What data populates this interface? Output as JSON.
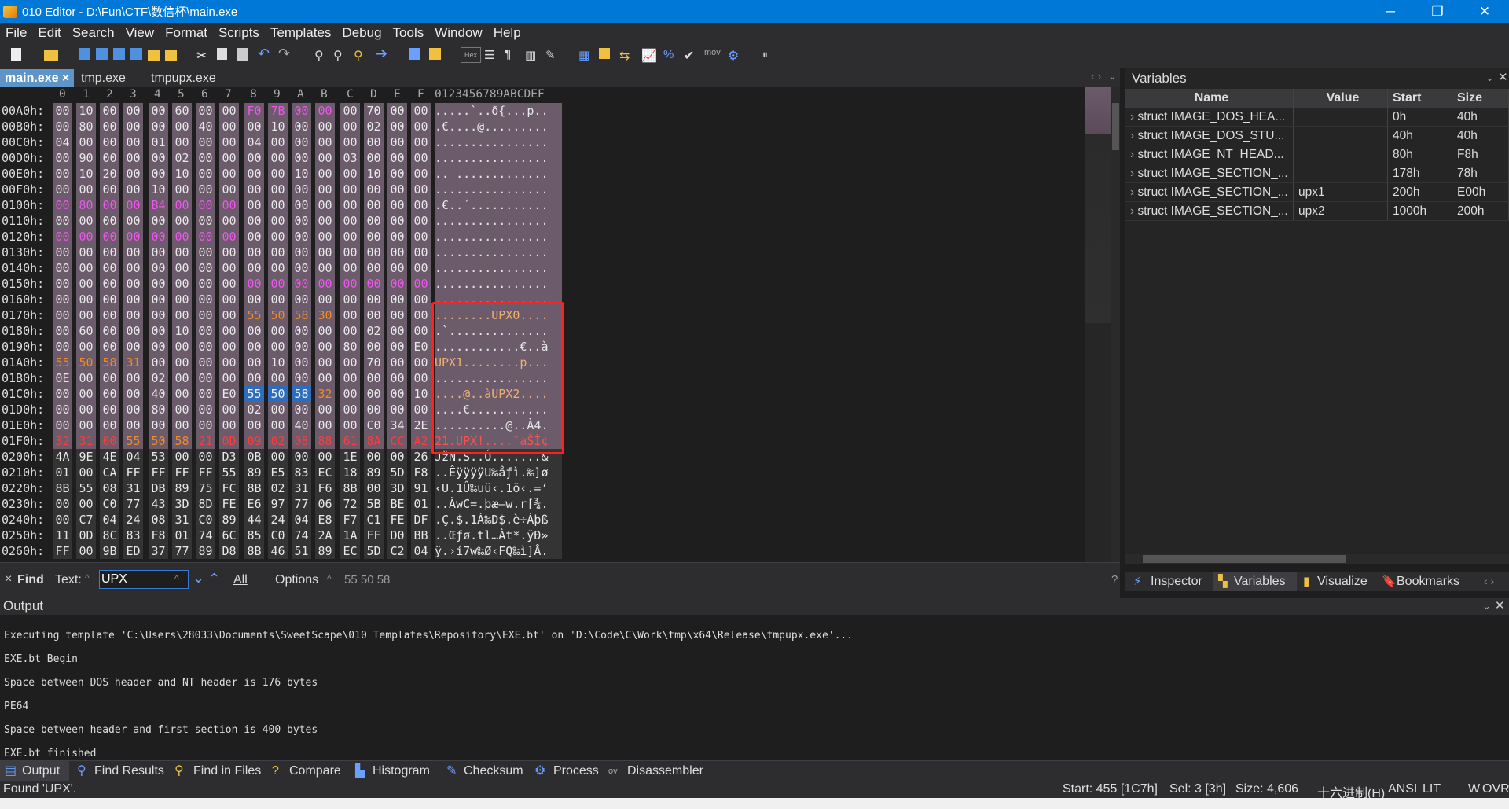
{
  "window": {
    "title": "010 Editor - D:\\Fun\\CTF\\数信杯\\main.exe",
    "min": "─",
    "max": "❐",
    "close": "✕"
  },
  "menu": [
    "File",
    "Edit",
    "Search",
    "View",
    "Format",
    "Scripts",
    "Templates",
    "Debug",
    "Tools",
    "Window",
    "Help"
  ],
  "tabs": [
    {
      "label": "main.exe ×",
      "active": true
    },
    {
      "label": "tmp.exe",
      "active": false
    },
    {
      "label": "tmpupx.exe",
      "active": false
    }
  ],
  "hex": {
    "columns": [
      "0",
      "1",
      "2",
      "3",
      "4",
      "5",
      "6",
      "7",
      "8",
      "9",
      "A",
      "B",
      "C",
      "D",
      "E",
      "F"
    ],
    "ascii_header": "0123456789ABCDEF",
    "rows": [
      {
        "addr": "00A0h:",
        "bytes": [
          "00",
          "10",
          "00",
          "00",
          "00",
          "60",
          "00",
          "00",
          "F0",
          "7B",
          "00",
          "00",
          "00",
          "70",
          "00",
          "00"
        ],
        "ascii": ".....`..ð{...p.."
      },
      {
        "addr": "00B0h:",
        "bytes": [
          "00",
          "80",
          "00",
          "00",
          "00",
          "00",
          "40",
          "00",
          "00",
          "10",
          "00",
          "00",
          "00",
          "02",
          "00",
          "00"
        ],
        "ascii": ".€....@........."
      },
      {
        "addr": "00C0h:",
        "bytes": [
          "04",
          "00",
          "00",
          "00",
          "01",
          "00",
          "00",
          "00",
          "04",
          "00",
          "00",
          "00",
          "00",
          "00",
          "00",
          "00"
        ],
        "ascii": "................"
      },
      {
        "addr": "00D0h:",
        "bytes": [
          "00",
          "90",
          "00",
          "00",
          "00",
          "02",
          "00",
          "00",
          "00",
          "00",
          "00",
          "00",
          "03",
          "00",
          "00",
          "00"
        ],
        "ascii": "................"
      },
      {
        "addr": "00E0h:",
        "bytes": [
          "00",
          "10",
          "20",
          "00",
          "00",
          "10",
          "00",
          "00",
          "00",
          "00",
          "10",
          "00",
          "00",
          "10",
          "00",
          "00"
        ],
        "ascii": ".. ............."
      },
      {
        "addr": "00F0h:",
        "bytes": [
          "00",
          "00",
          "00",
          "00",
          "10",
          "00",
          "00",
          "00",
          "00",
          "00",
          "00",
          "00",
          "00",
          "00",
          "00",
          "00"
        ],
        "ascii": "................"
      },
      {
        "addr": "0100h:",
        "bytes": [
          "00",
          "80",
          "00",
          "00",
          "B4",
          "00",
          "00",
          "00",
          "00",
          "00",
          "00",
          "00",
          "00",
          "00",
          "00",
          "00"
        ],
        "ascii": ".€..´..........."
      },
      {
        "addr": "0110h:",
        "bytes": [
          "00",
          "00",
          "00",
          "00",
          "00",
          "00",
          "00",
          "00",
          "00",
          "00",
          "00",
          "00",
          "00",
          "00",
          "00",
          "00"
        ],
        "ascii": "................"
      },
      {
        "addr": "0120h:",
        "bytes": [
          "00",
          "00",
          "00",
          "00",
          "00",
          "00",
          "00",
          "00",
          "00",
          "00",
          "00",
          "00",
          "00",
          "00",
          "00",
          "00"
        ],
        "ascii": "................"
      },
      {
        "addr": "0130h:",
        "bytes": [
          "00",
          "00",
          "00",
          "00",
          "00",
          "00",
          "00",
          "00",
          "00",
          "00",
          "00",
          "00",
          "00",
          "00",
          "00",
          "00"
        ],
        "ascii": "................"
      },
      {
        "addr": "0140h:",
        "bytes": [
          "00",
          "00",
          "00",
          "00",
          "00",
          "00",
          "00",
          "00",
          "00",
          "00",
          "00",
          "00",
          "00",
          "00",
          "00",
          "00"
        ],
        "ascii": "................"
      },
      {
        "addr": "0150h:",
        "bytes": [
          "00",
          "00",
          "00",
          "00",
          "00",
          "00",
          "00",
          "00",
          "00",
          "00",
          "00",
          "00",
          "00",
          "00",
          "00",
          "00"
        ],
        "ascii": "................"
      },
      {
        "addr": "0160h:",
        "bytes": [
          "00",
          "00",
          "00",
          "00",
          "00",
          "00",
          "00",
          "00",
          "00",
          "00",
          "00",
          "00",
          "00",
          "00",
          "00",
          "00"
        ],
        "ascii": "................"
      },
      {
        "addr": "0170h:",
        "bytes": [
          "00",
          "00",
          "00",
          "00",
          "00",
          "00",
          "00",
          "00",
          "55",
          "50",
          "58",
          "30",
          "00",
          "00",
          "00",
          "00"
        ],
        "ascii": "........UPX0...."
      },
      {
        "addr": "0180h:",
        "bytes": [
          "00",
          "60",
          "00",
          "00",
          "00",
          "10",
          "00",
          "00",
          "00",
          "00",
          "00",
          "00",
          "00",
          "02",
          "00",
          "00"
        ],
        "ascii": ".`.............."
      },
      {
        "addr": "0190h:",
        "bytes": [
          "00",
          "00",
          "00",
          "00",
          "00",
          "00",
          "00",
          "00",
          "00",
          "00",
          "00",
          "00",
          "80",
          "00",
          "00",
          "E0"
        ],
        "ascii": "............€..à"
      },
      {
        "addr": "01A0h:",
        "bytes": [
          "55",
          "50",
          "58",
          "31",
          "00",
          "00",
          "00",
          "00",
          "00",
          "10",
          "00",
          "00",
          "00",
          "70",
          "00",
          "00"
        ],
        "ascii": "UPX1........p..."
      },
      {
        "addr": "01B0h:",
        "bytes": [
          "0E",
          "00",
          "00",
          "00",
          "02",
          "00",
          "00",
          "00",
          "00",
          "00",
          "00",
          "00",
          "00",
          "00",
          "00",
          "00"
        ],
        "ascii": "................"
      },
      {
        "addr": "01C0h:",
        "bytes": [
          "00",
          "00",
          "00",
          "00",
          "40",
          "00",
          "00",
          "E0",
          "55",
          "50",
          "58",
          "32",
          "00",
          "00",
          "00",
          "10"
        ],
        "ascii": "....@..àUPX2...."
      },
      {
        "addr": "01D0h:",
        "bytes": [
          "00",
          "00",
          "00",
          "00",
          "80",
          "00",
          "00",
          "00",
          "02",
          "00",
          "00",
          "00",
          "00",
          "00",
          "00",
          "00"
        ],
        "ascii": "....€..........."
      },
      {
        "addr": "01E0h:",
        "bytes": [
          "00",
          "00",
          "00",
          "00",
          "00",
          "00",
          "00",
          "00",
          "00",
          "00",
          "40",
          "00",
          "00",
          "C0",
          "34",
          "2E"
        ],
        "ascii": "..........@..À4."
      },
      {
        "addr": "01F0h:",
        "bytes": [
          "32",
          "31",
          "00",
          "55",
          "50",
          "58",
          "21",
          "0D",
          "09",
          "02",
          "08",
          "88",
          "61",
          "8A",
          "CC",
          "A2"
        ],
        "ascii": "21.UPX!....ˆaŠÌ¢"
      },
      {
        "addr": "0200h:",
        "bytes": [
          "4A",
          "9E",
          "4E",
          "04",
          "53",
          "00",
          "00",
          "D3",
          "0B",
          "00",
          "00",
          "00",
          "1E",
          "00",
          "00",
          "26"
        ],
        "ascii": "JžN.S..Ó.......&"
      },
      {
        "addr": "0210h:",
        "bytes": [
          "01",
          "00",
          "CA",
          "FF",
          "FF",
          "FF",
          "FF",
          "55",
          "89",
          "E5",
          "83",
          "EC",
          "18",
          "89",
          "5D",
          "F8"
        ],
        "ascii": "..ÊÿÿÿÿU‰åƒì.‰]ø"
      },
      {
        "addr": "0220h:",
        "bytes": [
          "8B",
          "55",
          "08",
          "31",
          "DB",
          "89",
          "75",
          "FC",
          "8B",
          "02",
          "31",
          "F6",
          "8B",
          "00",
          "3D",
          "91"
        ],
        "ascii": "‹U.1Û‰uü‹.1ö‹.=‘"
      },
      {
        "addr": "0230h:",
        "bytes": [
          "00",
          "00",
          "C0",
          "77",
          "43",
          "3D",
          "8D",
          "FE",
          "E6",
          "97",
          "77",
          "06",
          "72",
          "5B",
          "BE",
          "01"
        ],
        "ascii": "..ÀwC=.þæ—w.r[¾."
      },
      {
        "addr": "0240h:",
        "bytes": [
          "00",
          "C7",
          "04",
          "24",
          "08",
          "31",
          "C0",
          "89",
          "44",
          "24",
          "04",
          "E8",
          "F7",
          "C1",
          "FE",
          "DF"
        ],
        "ascii": ".Ç.$.1À‰D$.è÷Áþß"
      },
      {
        "addr": "0250h:",
        "bytes": [
          "11",
          "0D",
          "8C",
          "83",
          "F8",
          "01",
          "74",
          "6C",
          "85",
          "C0",
          "74",
          "2A",
          "1A",
          "FF",
          "D0",
          "BB"
        ],
        "ascii": "..Œƒø.tl…Àt*.ÿÐ»"
      },
      {
        "addr": "0260h:",
        "bytes": [
          "FF",
          "00",
          "9B",
          "ED",
          "37",
          "77",
          "89",
          "D8",
          "8B",
          "46",
          "51",
          "89",
          "EC",
          "5D",
          "C2",
          "04"
        ],
        "ascii": "ÿ.›í7w‰Ø‹FQ‰ì]Â."
      }
    ]
  },
  "variables": {
    "title": "Variables",
    "columns": [
      "Name",
      "Value",
      "Start",
      "Size"
    ],
    "rows": [
      {
        "name": "struct IMAGE_DOS_HEA...",
        "value": "",
        "start": "0h",
        "size": "40h"
      },
      {
        "name": "struct IMAGE_DOS_STU...",
        "value": "",
        "start": "40h",
        "size": "40h"
      },
      {
        "name": "struct IMAGE_NT_HEAD...",
        "value": "",
        "start": "80h",
        "size": "F8h"
      },
      {
        "name": "struct IMAGE_SECTION_...",
        "value": "",
        "start": "178h",
        "size": "78h"
      },
      {
        "name": "struct IMAGE_SECTION_...",
        "value": "upx1",
        "start": "200h",
        "size": "E00h"
      },
      {
        "name": "struct IMAGE_SECTION_...",
        "value": "upx2",
        "start": "1000h",
        "size": "200h"
      }
    ]
  },
  "right_tabs": [
    "Inspector",
    "Variables",
    "Visualize",
    "Bookmarks"
  ],
  "find": {
    "close": "×",
    "label": "Find",
    "text_label": "Text:",
    "value": "UPX",
    "all": "All",
    "options": "Options",
    "hex": "55 50 58",
    "help": "?"
  },
  "output": {
    "title": "Output",
    "lines": [
      "Executing template 'C:\\Users\\28033\\Documents\\SweetScape\\010 Templates\\Repository\\EXE.bt' on 'D:\\Code\\C\\Work\\tmp\\x64\\Release\\tmpupx.exe'...",
      "EXE.bt Begin",
      "Space between DOS header and NT header is 176 bytes",
      "PE64",
      "Space between header and first section is 400 bytes",
      "EXE.bt finished"
    ]
  },
  "bottom_tabs": [
    "Output",
    "Find Results",
    "Find in Files",
    "Compare",
    "Histogram",
    "Checksum",
    "Process",
    "Disassembler"
  ],
  "status": {
    "message": "Found 'UPX'.",
    "start": "Start: 455 [1C7h]",
    "sel": "Sel: 3 [3h]",
    "size": "Size: 4,606",
    "mode": "十六进制(H)",
    "enc": "ANSI",
    "lit": "LIT",
    "w": "W",
    "ovr": "OVR"
  },
  "colors": {
    "struct": "#6a5a6a",
    "found": "#e07820",
    "selected": "#2e6dbe",
    "magenta": "#e040e0",
    "red": "#ee3030",
    "highlight_box": "#ff2020"
  }
}
